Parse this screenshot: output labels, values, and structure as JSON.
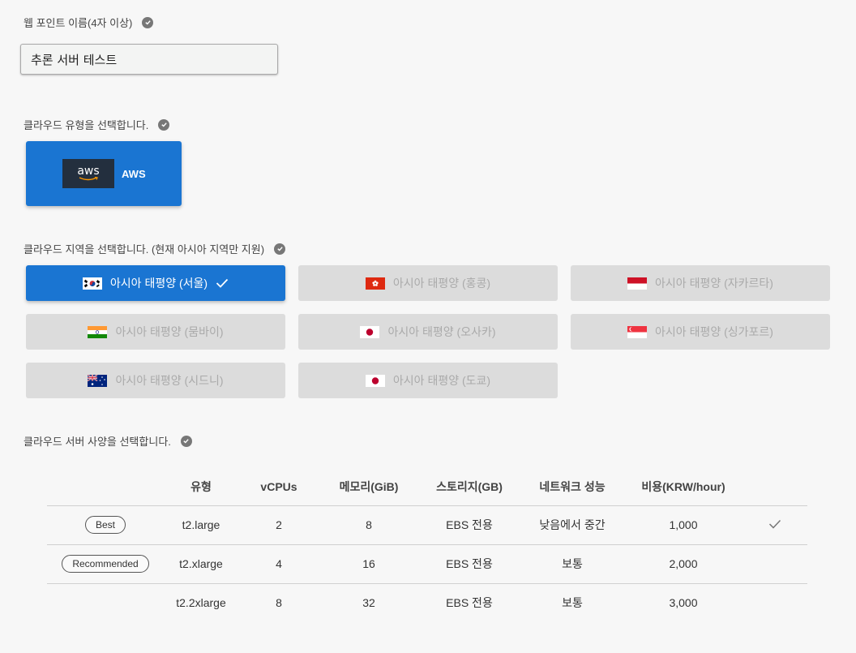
{
  "webpoint": {
    "label": "웹 포인트 이름(4자 이상)",
    "value": "추론 서버 테스트"
  },
  "cloud_type": {
    "label": "클라우드 유형을 선택합니다.",
    "options": [
      {
        "label": "AWS",
        "logo_text": "aws",
        "selected": true
      }
    ]
  },
  "region": {
    "label": "클라우드 지역을 선택합니다. (현재 아시아 지역만 지원)",
    "options": [
      {
        "label": "아시아 태평양 (서울)",
        "flag": "flag-korea",
        "selected": true,
        "enabled": true
      },
      {
        "label": "아시아 태평양 (홍콩)",
        "flag": "flag-hongkong",
        "selected": false,
        "enabled": false
      },
      {
        "label": "아시아 태평양 (자카르타)",
        "flag": "flag-indonesia",
        "selected": false,
        "enabled": false
      },
      {
        "label": "아시아 태평양 (뭄바이)",
        "flag": "flag-india",
        "selected": false,
        "enabled": false
      },
      {
        "label": "아시아 태평양 (오사카)",
        "flag": "flag-japan",
        "selected": false,
        "enabled": false
      },
      {
        "label": "아시아 태평양 (싱가포르)",
        "flag": "flag-singapore",
        "selected": false,
        "enabled": false
      },
      {
        "label": "아시아 태평양 (시드니)",
        "flag": "flag-australia",
        "selected": false,
        "enabled": false
      },
      {
        "label": "아시아 태평양 (도쿄)",
        "flag": "flag-japan",
        "selected": false,
        "enabled": false
      }
    ]
  },
  "server_spec": {
    "label": "클라우드 서버 사양을 선택합니다.",
    "columns": [
      "",
      "유형",
      "vCPUs",
      "메모리(GiB)",
      "스토리지(GB)",
      "네트워크 성능",
      "비용(KRW/hour)",
      ""
    ],
    "rows": [
      {
        "badge": "Best",
        "type": "t2.large",
        "vcpus": "2",
        "memory": "8",
        "storage": "EBS 전용",
        "network": "낮음에서 중간",
        "cost": "1,000",
        "selected": true
      },
      {
        "badge": "Recommended",
        "type": "t2.xlarge",
        "vcpus": "4",
        "memory": "16",
        "storage": "EBS 전용",
        "network": "보통",
        "cost": "2,000",
        "selected": false
      },
      {
        "badge": "",
        "type": "t2.2xlarge",
        "vcpus": "8",
        "memory": "32",
        "storage": "EBS 전용",
        "network": "보통",
        "cost": "3,000",
        "selected": false
      }
    ]
  },
  "colors": {
    "accent": "#1a75d2",
    "disabled_bg": "#dcdcdc",
    "disabled_text": "#aaaaaa",
    "check_gray": "#777777"
  }
}
